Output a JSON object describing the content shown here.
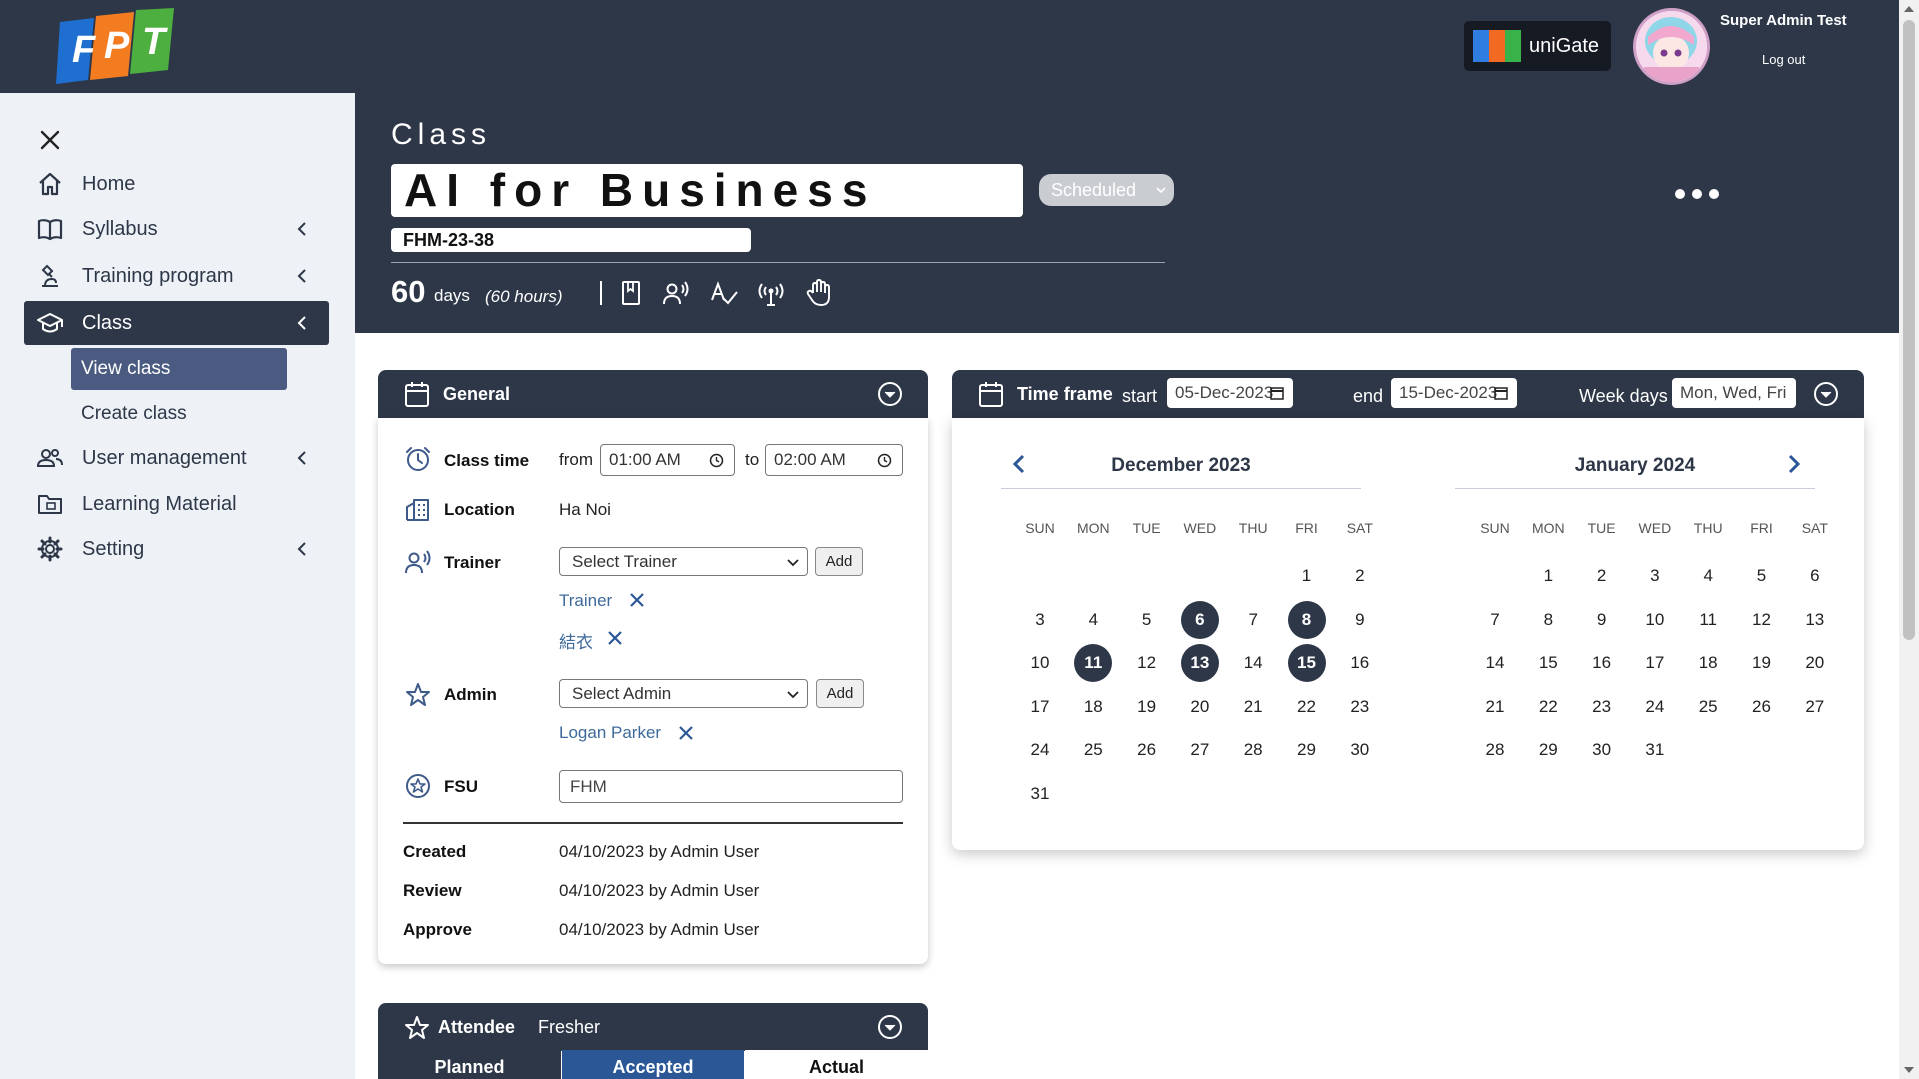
{
  "user": {
    "name": "Super Admin Test",
    "logout_label": "Log out"
  },
  "unigate": {
    "label": "uniGate"
  },
  "logo": {
    "text": "FPT"
  },
  "sidebar": {
    "items": [
      {
        "label": "Home",
        "icon": "home-icon"
      },
      {
        "label": "Syllabus",
        "icon": "book-icon"
      },
      {
        "label": "Training program",
        "icon": "microscope-icon"
      },
      {
        "label": "Class",
        "icon": "graduation-cap-icon"
      },
      {
        "label": "User management",
        "icon": "users-icon"
      },
      {
        "label": "Learning Material",
        "icon": "folder-icon"
      },
      {
        "label": "Setting",
        "icon": "gear-icon"
      }
    ],
    "class_sub": [
      {
        "label": "View class"
      },
      {
        "label": "Create class"
      }
    ]
  },
  "class": {
    "label": "Class",
    "name": "AI for Business",
    "status": "Scheduled",
    "code": "FHM-23-38",
    "duration_days": "60",
    "days_label": "days",
    "hours_label": "(60 hours)"
  },
  "general": {
    "title": "General",
    "class_time_label": "Class time",
    "from_label": "from",
    "from_time": "01:00 AM",
    "to_label": "to",
    "to_time": "02:00 AM",
    "location_label": "Location",
    "location": "Ha Noi",
    "trainer_label": "Trainer",
    "trainer_select": "Select Trainer",
    "add_label": "Add",
    "trainers": [
      "Trainer",
      "結衣"
    ],
    "admin_label": "Admin",
    "admin_select": "Select Admin",
    "admins": [
      "Logan Parker"
    ],
    "fsu_label": "FSU",
    "fsu_value": "FHM",
    "created_label": "Created",
    "created_value": "04/10/2023 by Admin User",
    "review_label": "Review",
    "review_value": "04/10/2023 by Admin User",
    "approve_label": "Approve",
    "approve_value": "04/10/2023 by Admin User"
  },
  "timeframe": {
    "title": "Time frame",
    "start_label": "start",
    "start_date": "05-Dec-2023",
    "end_label": "end",
    "end_date": "15-Dec-2023",
    "weekdays_label": "Week days",
    "weekdays": "Mon, Wed, Fri",
    "dow": [
      "SUN",
      "MON",
      "TUE",
      "WED",
      "THU",
      "FRI",
      "SAT"
    ],
    "months": [
      {
        "title": "December 2023",
        "first_weekday": 5,
        "days": 31,
        "selected": [
          6,
          8,
          11,
          13,
          15
        ]
      },
      {
        "title": "January 2024",
        "first_weekday": 1,
        "days": 31,
        "selected": []
      }
    ]
  },
  "attendee": {
    "title": "Attendee",
    "type": "Fresher",
    "tabs": [
      "Planned",
      "Accepted",
      "Actual"
    ]
  },
  "colors": {
    "navy": "#2d3748",
    "accent_blue": "#2b5797",
    "link": "#3d6a9a"
  }
}
